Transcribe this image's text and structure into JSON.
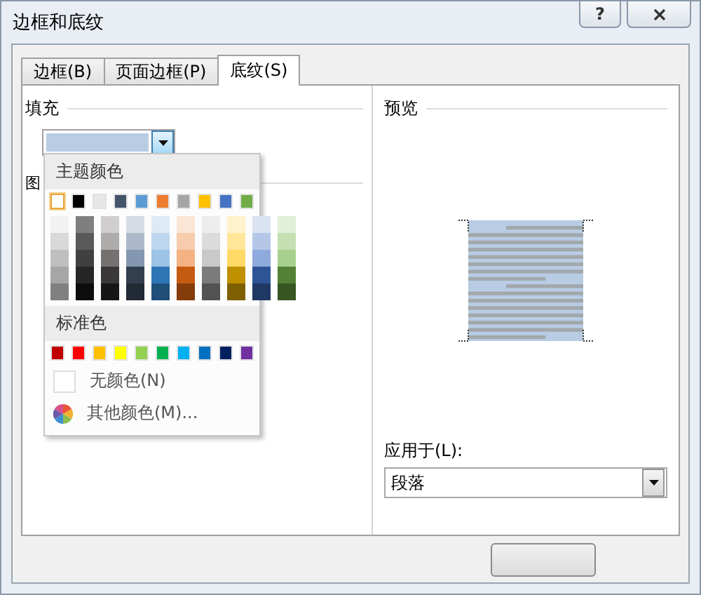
{
  "window": {
    "title": "边框和底纹",
    "help_button": "?"
  },
  "tabs": [
    {
      "label": "边框(B)",
      "selected": false
    },
    {
      "label": "页面边框(P)",
      "selected": false
    },
    {
      "label": "底纹(S)",
      "selected": true
    }
  ],
  "fill": {
    "heading": "填充",
    "color": "#b8cce4",
    "expanded": true
  },
  "pattern": {
    "heading": "图"
  },
  "color_menu": {
    "theme_heading": "主题颜色",
    "theme_colors": [
      {
        "color": "#ffffff",
        "selected": true,
        "shades": [
          {
            "color": "#f2f2f2"
          },
          {
            "color": "#d9d9d9"
          },
          {
            "color": "#bfbfbf"
          },
          {
            "color": "#a6a6a6"
          },
          {
            "color": "#808080"
          }
        ]
      },
      {
        "color": "#000000",
        "selected": false,
        "shades": [
          {
            "color": "#7f7f7f"
          },
          {
            "color": "#595959"
          },
          {
            "color": "#404040"
          },
          {
            "color": "#262626"
          },
          {
            "color": "#0d0d0d"
          }
        ]
      },
      {
        "color": "#e7e6e6",
        "selected": false,
        "shades": [
          {
            "color": "#d0cece"
          },
          {
            "color": "#aeabab"
          },
          {
            "color": "#757171"
          },
          {
            "color": "#3a3838"
          },
          {
            "color": "#161616"
          }
        ]
      },
      {
        "color": "#44546a",
        "selected": false,
        "shades": [
          {
            "color": "#d6dce4"
          },
          {
            "color": "#adb9ca"
          },
          {
            "color": "#8497b0"
          },
          {
            "color": "#333f4f"
          },
          {
            "color": "#222a35"
          }
        ]
      },
      {
        "color": "#5b9bd5",
        "selected": false,
        "shades": [
          {
            "color": "#deebf6"
          },
          {
            "color": "#bdd7ee"
          },
          {
            "color": "#9dc3e6"
          },
          {
            "color": "#2e75b5"
          },
          {
            "color": "#1f4e79"
          }
        ]
      },
      {
        "color": "#ed7d31",
        "selected": false,
        "shades": [
          {
            "color": "#fbe5d5"
          },
          {
            "color": "#f7cbac"
          },
          {
            "color": "#f4b183"
          },
          {
            "color": "#c55a11"
          },
          {
            "color": "#843c0b"
          }
        ]
      },
      {
        "color": "#a5a5a5",
        "selected": false,
        "shades": [
          {
            "color": "#ededed"
          },
          {
            "color": "#dbdbdb"
          },
          {
            "color": "#c9c9c9"
          },
          {
            "color": "#7b7b7b"
          },
          {
            "color": "#525252"
          }
        ]
      },
      {
        "color": "#ffc000",
        "selected": false,
        "shades": [
          {
            "color": "#fff2cc"
          },
          {
            "color": "#ffe699"
          },
          {
            "color": "#ffd965"
          },
          {
            "color": "#bf9000"
          },
          {
            "color": "#7f6000"
          }
        ]
      },
      {
        "color": "#4472c4",
        "selected": false,
        "shades": [
          {
            "color": "#dae3f3"
          },
          {
            "color": "#b4c7e7"
          },
          {
            "color": "#8faadc"
          },
          {
            "color": "#2f5496"
          },
          {
            "color": "#1f3864"
          }
        ]
      },
      {
        "color": "#70ad47",
        "selected": false,
        "shades": [
          {
            "color": "#e2efd9"
          },
          {
            "color": "#c5e0b3"
          },
          {
            "color": "#a8d08d"
          },
          {
            "color": "#538135"
          },
          {
            "color": "#375623"
          }
        ]
      }
    ],
    "standard_heading": "标准色",
    "standard_colors": [
      {
        "color": "#c00000",
        "selected": false
      },
      {
        "color": "#ff0000",
        "selected": false
      },
      {
        "color": "#ffc000",
        "selected": false
      },
      {
        "color": "#ffff00",
        "selected": false
      },
      {
        "color": "#92d050",
        "selected": false
      },
      {
        "color": "#00b050",
        "selected": false
      },
      {
        "color": "#00b0f0",
        "selected": false
      },
      {
        "color": "#0070c0",
        "selected": false
      },
      {
        "color": "#002060",
        "selected": false
      },
      {
        "color": "#7030a0",
        "selected": false
      }
    ],
    "no_color": "无颜色(N)",
    "more_colors": "其他颜色(M)..."
  },
  "preview": {
    "heading": "预览"
  },
  "apply_to": {
    "label": "应用于(L):",
    "value": "段落"
  }
}
